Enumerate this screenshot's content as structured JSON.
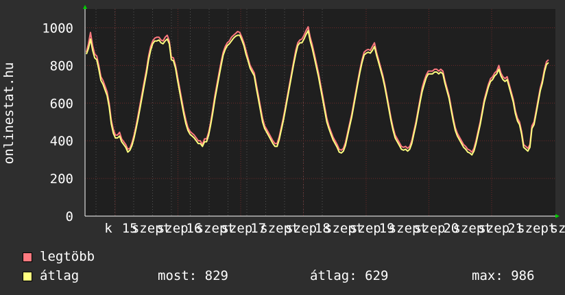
{
  "chart_data": {
    "type": "line",
    "ylabel": "onlinestat.hu",
    "ylim": [
      0,
      1100
    ],
    "yticks": [
      0,
      200,
      400,
      600,
      800,
      1000
    ],
    "grid": true,
    "xticks": [
      "k",
      "15",
      "szept",
      "szep",
      "16",
      "szept",
      "szep",
      "17",
      "szept",
      "szep",
      "18",
      "szept",
      "szep",
      "19",
      "szept",
      "szep",
      "20",
      "szept",
      "szep",
      "21",
      "szept",
      "sz"
    ],
    "series": [
      {
        "name": "legtöbb",
        "color": "#ff7a80",
        "values": [
          870,
          915,
          975,
          905,
          860,
          850,
          800,
          740,
          720,
          690,
          660,
          600,
          510,
          460,
          430,
          430,
          445,
          410,
          395,
          380,
          355,
          360,
          390,
          430,
          480,
          540,
          600,
          660,
          720,
          780,
          850,
          900,
          930,
          945,
          950,
          950,
          935,
          930,
          950,
          960,
          930,
          845,
          840,
          800,
          740,
          680,
          620,
          560,
          510,
          470,
          450,
          440,
          430,
          415,
          400,
          400,
          380,
          410,
          410,
          445,
          500,
          570,
          640,
          700,
          760,
          820,
          870,
          900,
          920,
          930,
          950,
          960,
          970,
          980,
          975,
          950,
          920,
          880,
          840,
          800,
          780,
          760,
          700,
          640,
          580,
          520,
          480,
          460,
          440,
          420,
          400,
          385,
          385,
          420,
          470,
          520,
          580,
          640,
          700,
          760,
          820,
          880,
          920,
          935,
          940,
          960,
          985,
          1005,
          950,
          910,
          860,
          810,
          760,
          700,
          640,
          580,
          520,
          480,
          450,
          420,
          400,
          380,
          355,
          350,
          360,
          390,
          440,
          490,
          540,
          600,
          660,
          720,
          780,
          830,
          870,
          880,
          885,
          880,
          900,
          920,
          870,
          830,
          790,
          750,
          700,
          640,
          580,
          520,
          470,
          430,
          410,
          390,
          370,
          365,
          370,
          360,
          370,
          400,
          450,
          500,
          560,
          620,
          680,
          720,
          750,
          770,
          770,
          770,
          780,
          780,
          770,
          780,
          770,
          720,
          680,
          640,
          580,
          520,
          470,
          440,
          420,
          400,
          380,
          370,
          355,
          350,
          340,
          360,
          400,
          450,
          500,
          560,
          620,
          660,
          700,
          730,
          740,
          760,
          770,
          800,
          760,
          740,
          730,
          740,
          700,
          660,
          620,
          560,
          520,
          500,
          450,
          380,
          370,
          360,
          380,
          480,
          500,
          560,
          620,
          680,
          720,
          780,
          820,
          830
        ]
      },
      {
        "name": "átlag",
        "color": "#ffff80",
        "values": [
          860,
          890,
          940,
          880,
          840,
          830,
          780,
          720,
          700,
          670,
          640,
          580,
          490,
          440,
          415,
          415,
          425,
          395,
          380,
          365,
          340,
          350,
          375,
          415,
          465,
          520,
          580,
          640,
          700,
          760,
          830,
          880,
          915,
          930,
          930,
          935,
          920,
          915,
          930,
          940,
          915,
          830,
          825,
          785,
          720,
          660,
          600,
          540,
          490,
          455,
          435,
          425,
          415,
          400,
          385,
          385,
          370,
          395,
          395,
          430,
          485,
          550,
          620,
          680,
          740,
          800,
          855,
          885,
          905,
          915,
          930,
          945,
          955,
          960,
          960,
          935,
          905,
          860,
          825,
          785,
          765,
          745,
          680,
          620,
          560,
          500,
          465,
          445,
          425,
          405,
          385,
          370,
          370,
          405,
          455,
          505,
          565,
          625,
          685,
          745,
          805,
          860,
          905,
          920,
          920,
          940,
          965,
          985,
          930,
          890,
          840,
          790,
          740,
          680,
          620,
          560,
          500,
          465,
          435,
          405,
          385,
          365,
          340,
          335,
          345,
          375,
          425,
          475,
          525,
          585,
          645,
          705,
          765,
          815,
          855,
          865,
          870,
          865,
          880,
          900,
          855,
          815,
          775,
          735,
          685,
          625,
          565,
          505,
          455,
          415,
          395,
          375,
          355,
          350,
          355,
          345,
          355,
          385,
          435,
          485,
          545,
          605,
          660,
          700,
          735,
          755,
          755,
          755,
          765,
          765,
          755,
          765,
          755,
          705,
          665,
          625,
          565,
          505,
          455,
          425,
          405,
          385,
          365,
          355,
          340,
          335,
          325,
          345,
          385,
          435,
          485,
          545,
          605,
          645,
          685,
          715,
          725,
          745,
          755,
          780,
          745,
          725,
          715,
          725,
          685,
          645,
          605,
          545,
          505,
          485,
          435,
          365,
          355,
          345,
          365,
          465,
          485,
          545,
          605,
          665,
          705,
          765,
          805,
          815
        ]
      }
    ],
    "legend": [
      {
        "label": "legtöbb",
        "color": "#ff7a80"
      },
      {
        "label": "átlag",
        "color": "#ffff80"
      }
    ],
    "stats": {
      "now": "most: 829",
      "avg": "átlag: 629",
      "max": "max: 986"
    }
  }
}
